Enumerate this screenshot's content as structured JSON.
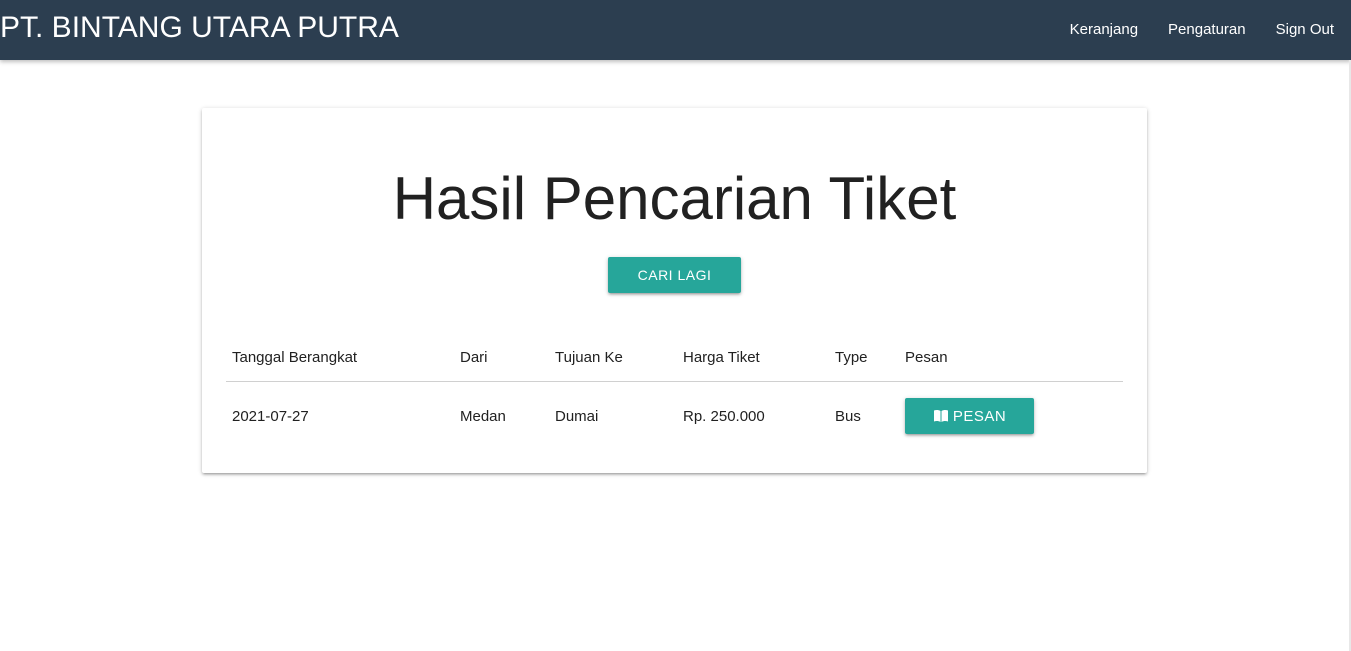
{
  "navbar": {
    "brand": "PT. BINTANG UTARA PUTRA",
    "links": [
      "Keranjang",
      "Pengaturan",
      "Sign Out"
    ]
  },
  "main": {
    "title": "Hasil Pencarian Tiket",
    "search_again_label": "CARI LAGI",
    "table": {
      "headers": [
        "Tanggal Berangkat",
        "Dari",
        "Tujuan Ke",
        "Harga Tiket",
        "Type",
        "Pesan"
      ],
      "rows": [
        {
          "tanggal": "2021-07-27",
          "dari": "Medan",
          "tujuan": "Dumai",
          "harga": "Rp. 250.000",
          "type": "Bus",
          "pesan_label": "PESAN",
          "pesan_icon": "book-icon"
        }
      ]
    }
  },
  "colors": {
    "navbar": "#2c3e50",
    "accent": "#26a69a"
  }
}
